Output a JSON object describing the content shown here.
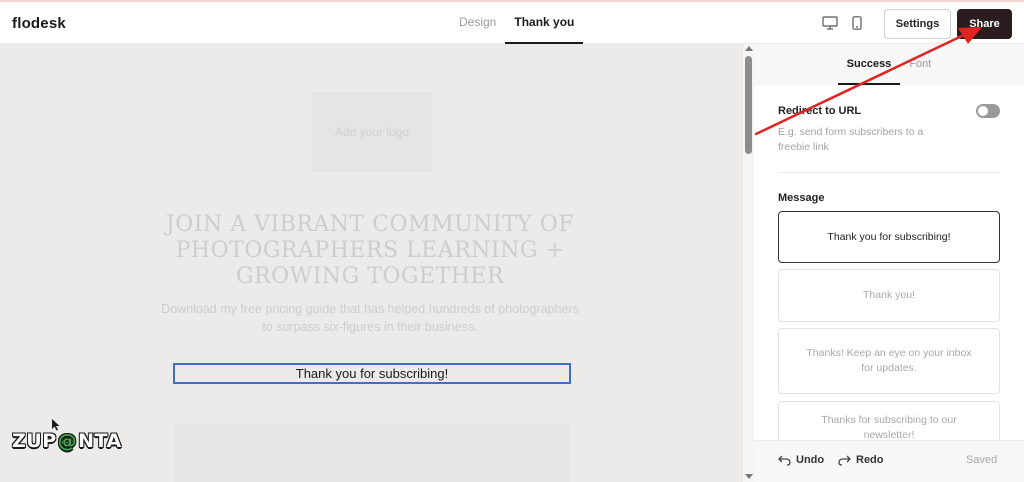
{
  "app": {
    "brand": "flodesk"
  },
  "header": {
    "tabs": [
      {
        "label": "Design",
        "active": false
      },
      {
        "label": "Thank you",
        "active": true
      }
    ],
    "device_icons": [
      "desktop-icon",
      "mobile-icon"
    ],
    "settings_label": "Settings",
    "share_label": "Share"
  },
  "canvas": {
    "logo_placeholder": "Add your logo",
    "headline": "JOIN A VIBRANT COMMUNITY OF PHOTOGRAPHERS LEARNING + GROWING TOGETHER",
    "subtext": "Download my free pricing guide that has helped hundreds of photographers to surpass six-figures in their business.",
    "thank_you_message": "Thank you for subscribing!",
    "watermark_left": "ZUP",
    "watermark_at": "@",
    "watermark_right": "NTA"
  },
  "panel": {
    "tabs": [
      {
        "label": "Success",
        "active": true
      },
      {
        "label": "Font",
        "active": false
      }
    ],
    "redirect": {
      "title": "Redirect to URL",
      "help": "E.g. send form subscribers to a freebie link",
      "enabled": false
    },
    "message_title": "Message",
    "message_options": [
      {
        "text": "Thank you for subscribing!",
        "selected": true
      },
      {
        "text": "Thank you!",
        "selected": false
      },
      {
        "text": "Thanks! Keep an eye on your inbox for updates.",
        "selected": false
      },
      {
        "text": "Thanks for subscribing to our newsletter!",
        "selected": false
      }
    ],
    "footer": {
      "undo_label": "Undo",
      "redo_label": "Redo",
      "status": "Saved"
    }
  },
  "colors": {
    "share_bg": "#2b1d1d",
    "selection_blue": "#3d6fd1",
    "arrow_red": "#e02424",
    "canvas_bg": "#ecebea"
  }
}
